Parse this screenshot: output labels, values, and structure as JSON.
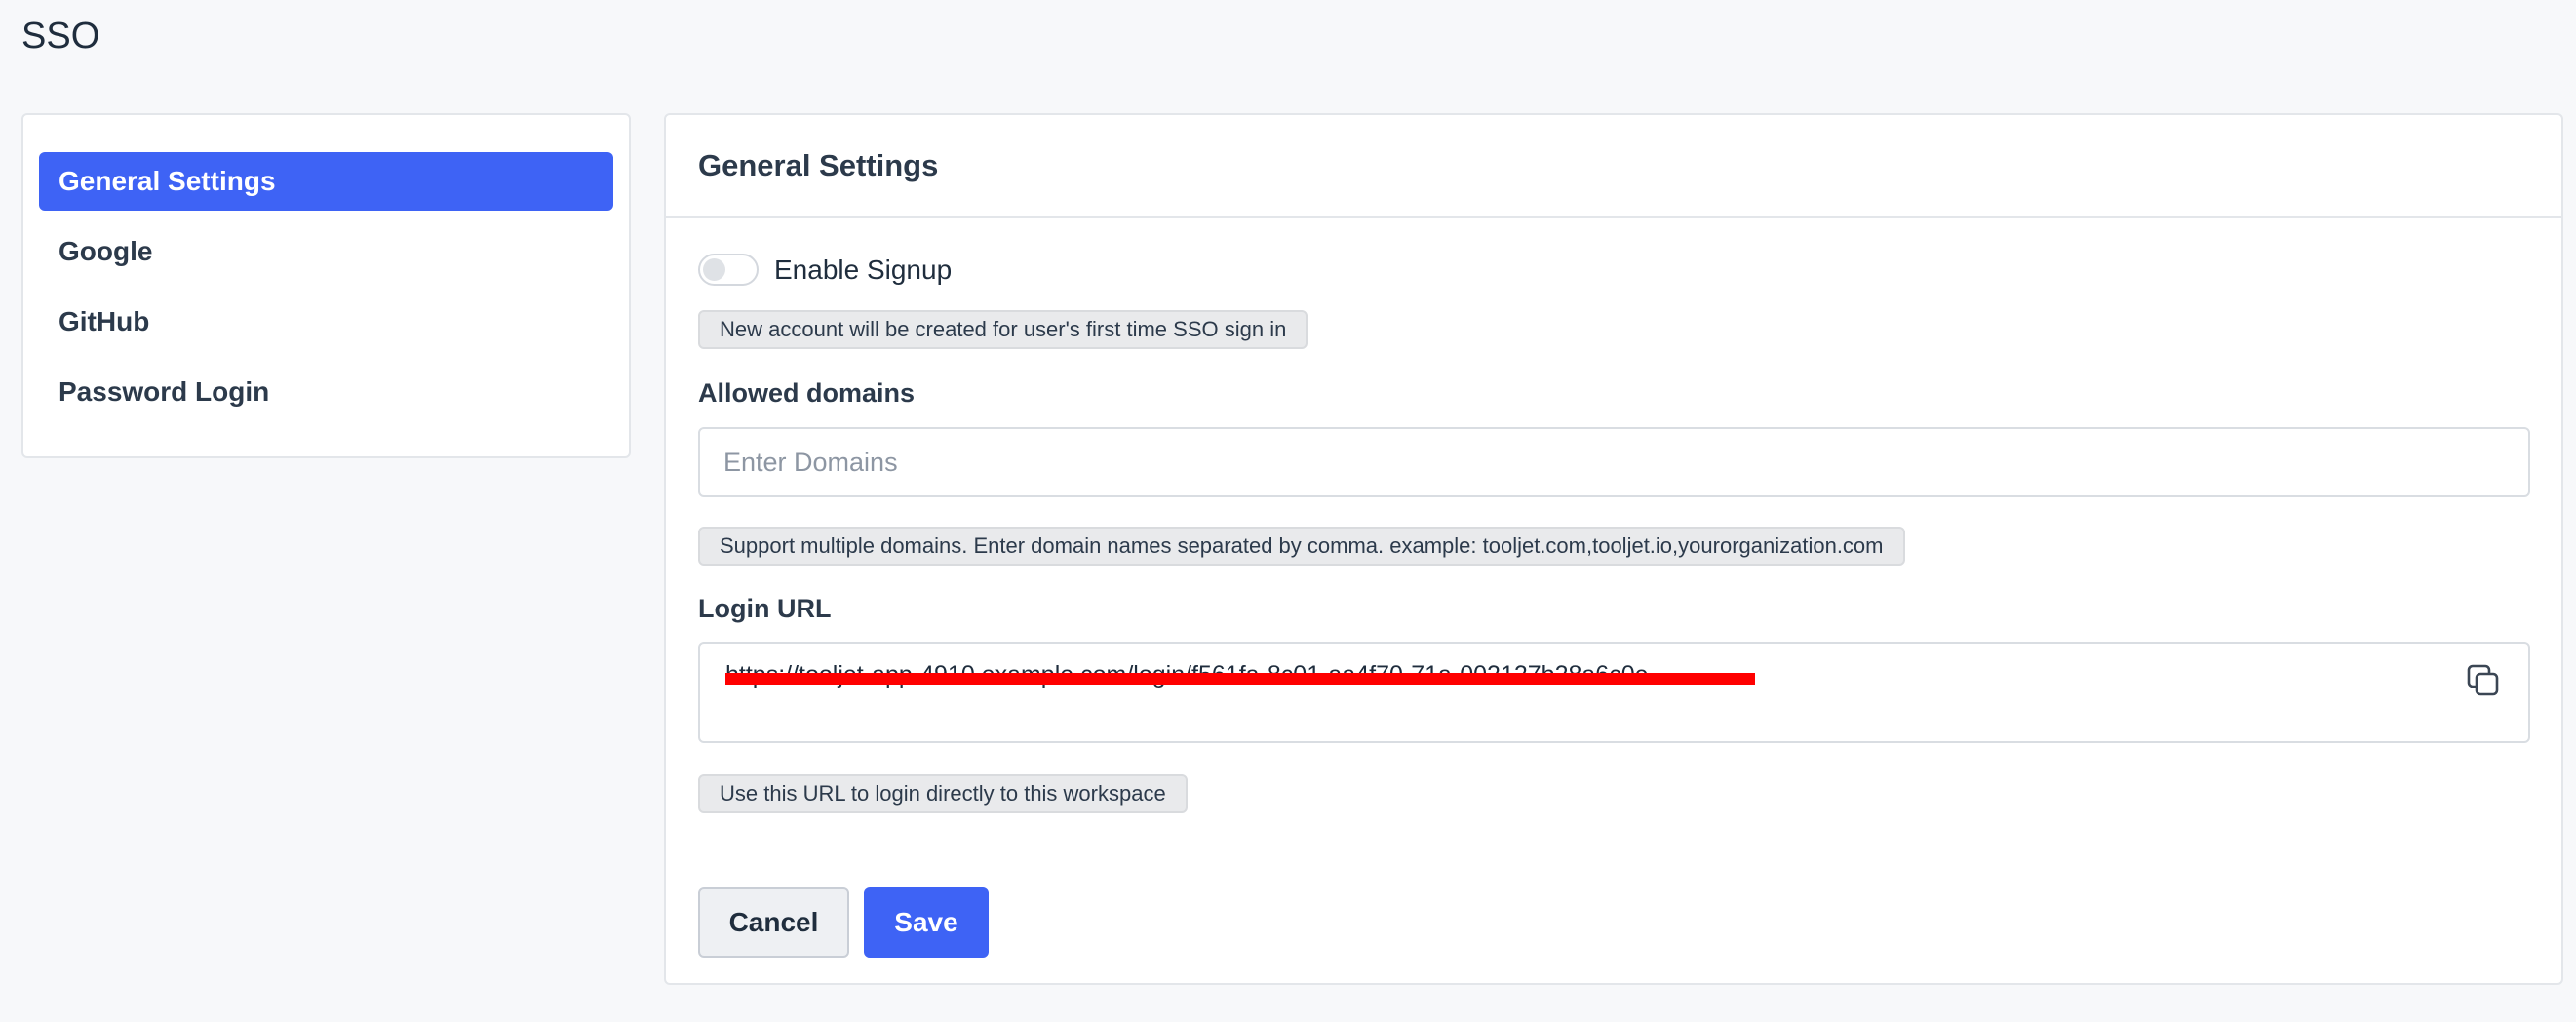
{
  "page": {
    "title": "SSO"
  },
  "sidebar": {
    "items": [
      {
        "label": "General Settings",
        "active": true
      },
      {
        "label": "Google",
        "active": false
      },
      {
        "label": "GitHub",
        "active": false
      },
      {
        "label": "Password Login",
        "active": false
      }
    ]
  },
  "general_settings": {
    "title": "General Settings",
    "enable_signup": {
      "label": "Enable Signup",
      "enabled": false,
      "hint": "New account will be created for user's first time SSO sign in"
    },
    "allowed_domains": {
      "label": "Allowed domains",
      "value": "",
      "placeholder": "Enter Domains",
      "hint": "Support multiple domains. Enter domain names separated by comma. example: tooljet.com,tooljet.io,yourorganization.com"
    },
    "login_url": {
      "label": "Login URL",
      "value": "https://tooljet-app-4910.example.com/login/f561fa-8c01-aa4f70-71a-002127b28a6c0e",
      "redacted": true,
      "hint": "Use this URL to login directly to this workspace",
      "copy_icon": "copy-icon"
    },
    "buttons": {
      "cancel": "Cancel",
      "save": "Save"
    }
  },
  "colors": {
    "accent": "#3e63f5",
    "background": "#f7f8fa",
    "redaction": "#ff0000"
  }
}
